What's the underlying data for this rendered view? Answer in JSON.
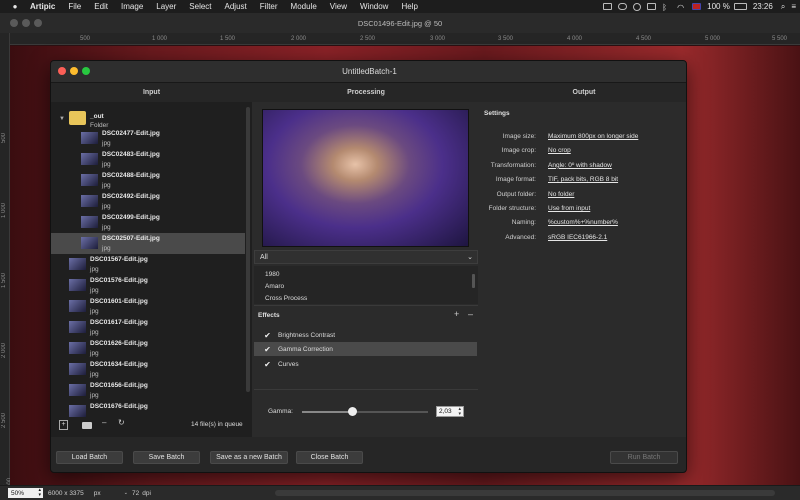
{
  "menubar": {
    "app": "Artipic",
    "items": [
      "File",
      "Edit",
      "Image",
      "Layer",
      "Select",
      "Adjust",
      "Filter",
      "Module",
      "View",
      "Window",
      "Help"
    ],
    "battery": "100 %",
    "time": "23:26"
  },
  "document": {
    "title": "DSC01496-Edit.jpg @ 50"
  },
  "ruler": {
    "top": [
      "500",
      "1 000",
      "1 500",
      "2 000",
      "2 500",
      "3 000",
      "3 500",
      "4 000",
      "4 500",
      "5 000",
      "5 500"
    ],
    "left": [
      "500",
      "1 000",
      "1 500",
      "2 000",
      "2 500",
      "3 000"
    ]
  },
  "batch": {
    "title": "UntitledBatch-1",
    "columns": {
      "input": "Input",
      "processing": "Processing",
      "output": "Output"
    },
    "input": {
      "folder": {
        "name": "_out",
        "type": "Folder"
      },
      "files": [
        {
          "name": "DSC02477-Edit.jpg",
          "ext": "jpg"
        },
        {
          "name": "DSC02483-Edit.jpg",
          "ext": "jpg"
        },
        {
          "name": "DSC02488-Edit.jpg",
          "ext": "jpg"
        },
        {
          "name": "DSC02492-Edit.jpg",
          "ext": "jpg"
        },
        {
          "name": "DSC02499-Edit.jpg",
          "ext": "jpg"
        },
        {
          "name": "DSC02507-Edit.jpg",
          "ext": "jpg",
          "selected": true
        },
        {
          "name": "DSC01567-Edit.jpg",
          "ext": "jpg"
        },
        {
          "name": "DSC01576-Edit.jpg",
          "ext": "jpg"
        },
        {
          "name": "DSC01601-Edit.jpg",
          "ext": "jpg"
        },
        {
          "name": "DSC01617-Edit.jpg",
          "ext": "jpg"
        },
        {
          "name": "DSC01626-Edit.jpg",
          "ext": "jpg"
        },
        {
          "name": "DSC01634-Edit.jpg",
          "ext": "jpg"
        },
        {
          "name": "DSC01656-Edit.jpg",
          "ext": "jpg"
        },
        {
          "name": "DSC01676-Edit.jpg",
          "ext": ""
        }
      ],
      "file_count": "14 file(s) in queue"
    },
    "processing": {
      "preset_filter": "All",
      "presets": [
        "1980",
        "Amaro",
        "Cross Process"
      ],
      "effects_label": "Effects",
      "effects": [
        {
          "name": "Brightness Contrast",
          "checked": true
        },
        {
          "name": "Gamma Correction",
          "checked": true,
          "selected": true
        },
        {
          "name": "Curves",
          "checked": true
        }
      ],
      "gamma_label": "Gamma:",
      "gamma_value": "2,03",
      "gamma_slider_fraction": 0.4
    },
    "output": {
      "settings_label": "Settings",
      "rows": [
        {
          "label": "Image size:",
          "value": "Maximum 800px on longer side"
        },
        {
          "label": "Image crop:",
          "value": "No crop"
        },
        {
          "label": "Transformation:",
          "value": "Angle: 0º with shadow"
        },
        {
          "label": "Image format:",
          "value": "TIF, pack bits, RGB 8 bit"
        },
        {
          "label": "Output folder:",
          "value": "No folder"
        },
        {
          "label": "Folder structure:",
          "value": "Use from input"
        },
        {
          "label": "Naming:",
          "value": "%custom%+%number%"
        },
        {
          "label": "Advanced:",
          "value": "sRGB IEC61966-2.1"
        }
      ]
    },
    "buttons": {
      "load": "Load Batch",
      "save": "Save Batch",
      "save_new": "Save as a new Batch",
      "close": "Close Batch",
      "run": "Run Batch"
    }
  },
  "status": {
    "zoom": "50%",
    "size": "6000 x 3375",
    "unit": "px",
    "dpi_value": "72",
    "dpi_label": "dpi"
  }
}
